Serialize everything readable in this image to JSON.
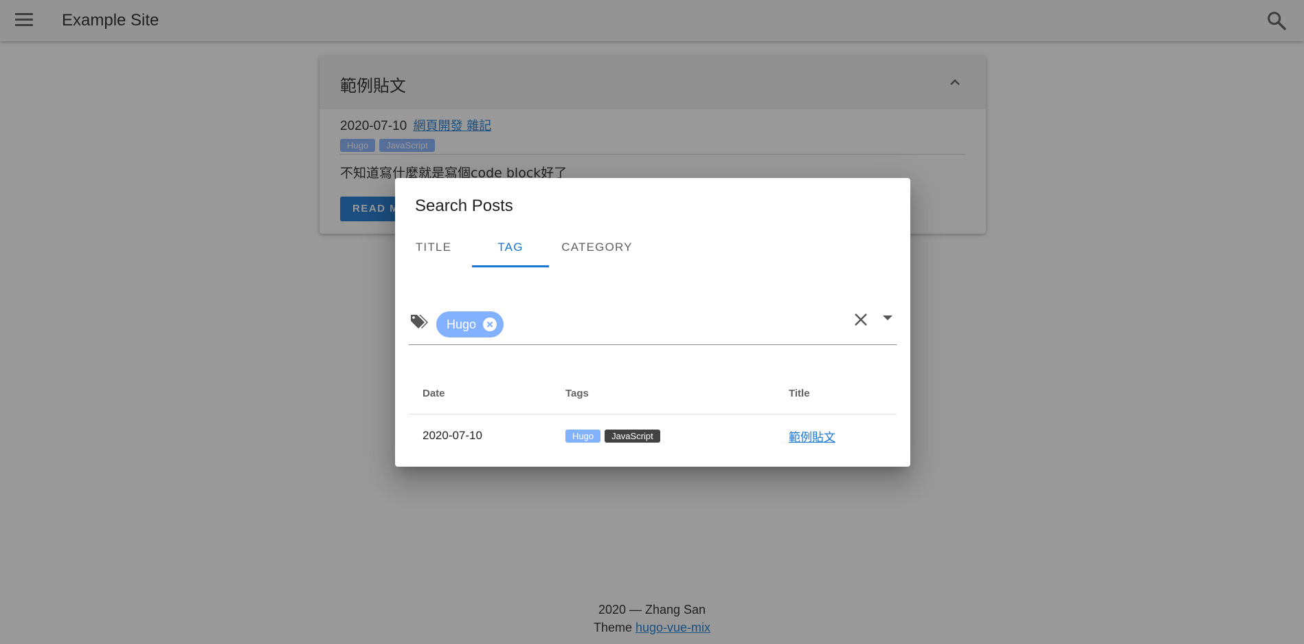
{
  "appbar": {
    "title": "Example Site"
  },
  "post": {
    "title": "範例貼文",
    "date": "2020-07-10",
    "categories": "網頁開發 雜記",
    "tags": [
      "Hugo",
      "JavaScript"
    ],
    "excerpt": "不知道寫什麼就是寫個code block好了",
    "read_more": "READ M"
  },
  "footer": {
    "line1": "2020 — Zhang San",
    "theme_prefix": "Theme ",
    "theme_link": "hugo-vue-mix"
  },
  "dialog": {
    "title": "Search Posts",
    "tabs": [
      "TITLE",
      "TAG",
      "CATEGORY"
    ],
    "active_tab": "TAG",
    "selected_tag": "Hugo",
    "table": {
      "headers": [
        "Date",
        "Tags",
        "Title"
      ],
      "rows": [
        {
          "date": "2020-07-10",
          "tags": [
            "Hugo",
            "JavaScript"
          ],
          "title": "範例貼文"
        }
      ]
    }
  },
  "colors": {
    "primary": "#1976d2",
    "chip_blue": "#82b1ff",
    "chip_dark": "#424242"
  }
}
